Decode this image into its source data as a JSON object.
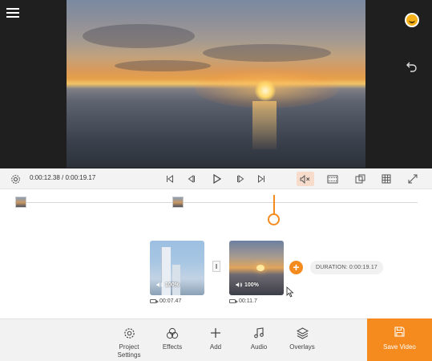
{
  "player": {
    "timecode": "0:00:12.38 / 0:00:19.17",
    "icons": [
      "settings-icon",
      "skip-start-icon",
      "step-back-icon",
      "play-icon",
      "step-forward-icon",
      "skip-end-icon",
      "mute-icon",
      "filmstrip-icon",
      "aspect-ratio-icon",
      "grid-icon",
      "fullscreen-icon"
    ]
  },
  "clips": [
    {
      "volume": "100%",
      "duration": "00:07.47"
    },
    {
      "volume": "100%",
      "duration": "00:11.7"
    }
  ],
  "duration_label": "DURATION: 0:00:19.17",
  "toolbar": {
    "items": [
      {
        "label": "Project Settings",
        "icon": "gear-icon"
      },
      {
        "label": "Effects",
        "icon": "effects-icon"
      },
      {
        "label": "Add",
        "icon": "plus-icon"
      },
      {
        "label": "Audio",
        "icon": "music-note-icon"
      },
      {
        "label": "Overlays",
        "icon": "layers-icon"
      }
    ],
    "save_label": "Save Video"
  },
  "colors": {
    "accent": "#f58a1f",
    "toolbar_bg": "#f2f2f2",
    "stage_bg": "#1f1f1f"
  }
}
